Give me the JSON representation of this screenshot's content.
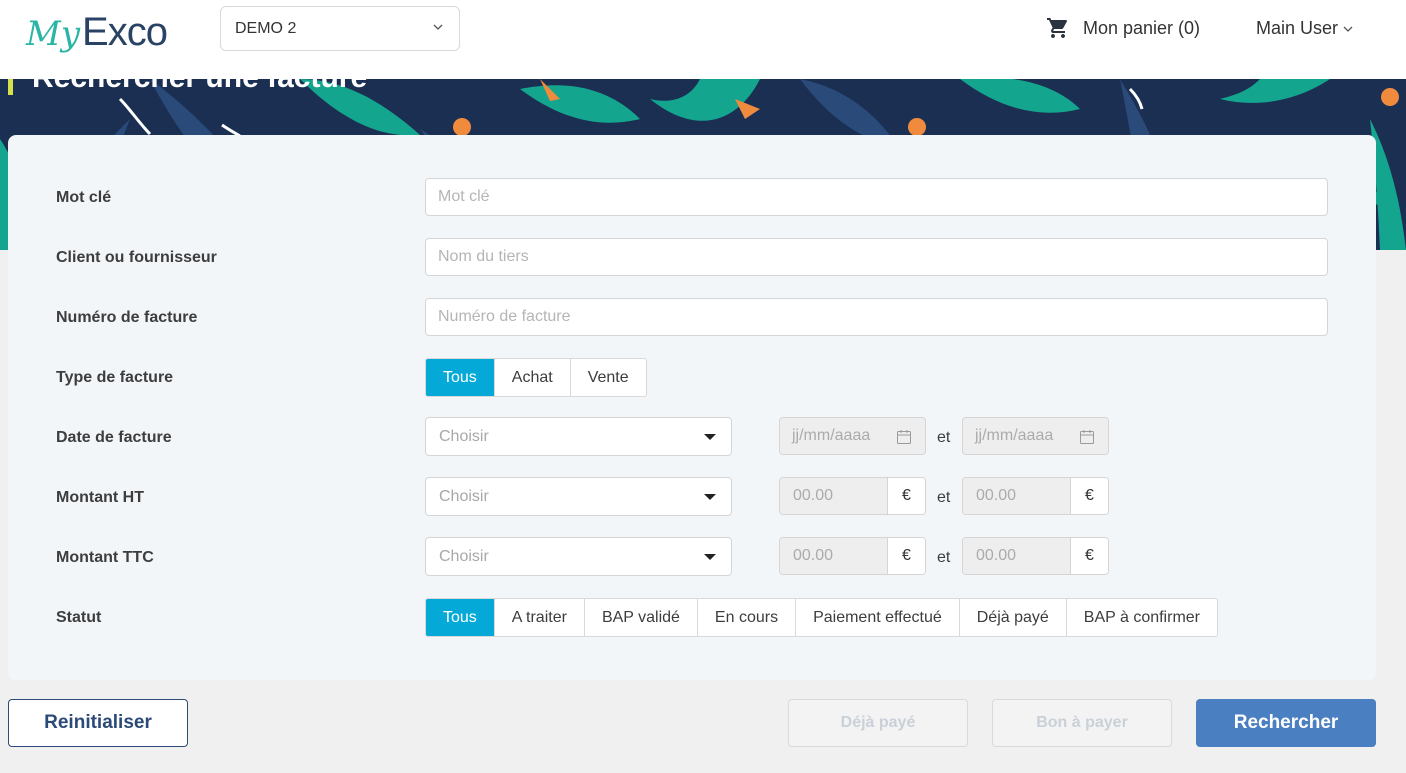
{
  "header": {
    "logo_my": "My",
    "logo_exco": "Exco",
    "company": "DEMO 2",
    "cart_label": "Mon panier (0)",
    "user_label": "Main User"
  },
  "page": {
    "title": "Rechercher une facture"
  },
  "form": {
    "keyword": {
      "label": "Mot clé",
      "placeholder": "Mot clé"
    },
    "party": {
      "label": "Client ou fournisseur",
      "placeholder": "Nom du tiers"
    },
    "invoice_number": {
      "label": "Numéro de facture",
      "placeholder": "Numéro de facture"
    },
    "invoice_type": {
      "label": "Type de facture",
      "options": [
        "Tous",
        "Achat",
        "Vente"
      ],
      "selected": "Tous"
    },
    "invoice_date": {
      "label": "Date de facture",
      "select_value": "Choisir",
      "from_placeholder": "jj/mm/aaaa",
      "to_placeholder": "jj/mm/aaaa",
      "between": "et"
    },
    "amount_ht": {
      "label": "Montant HT",
      "select_value": "Choisir",
      "from_value": "00.00",
      "to_value": "00.00",
      "currency": "€",
      "between": "et"
    },
    "amount_ttc": {
      "label": "Montant TTC",
      "select_value": "Choisir",
      "from_value": "00.00",
      "to_value": "00.00",
      "currency": "€",
      "between": "et"
    },
    "status": {
      "label": "Statut",
      "options": [
        "Tous",
        "A traiter",
        "BAP validé",
        "En cours",
        "Paiement effectué",
        "Déjà payé",
        "BAP à confirmer"
      ],
      "selected": "Tous"
    }
  },
  "actions": {
    "reset": "Reinitialiser",
    "already_paid": "Déjà payé",
    "good_to_pay": "Bon à payer",
    "search": "Rechercher"
  },
  "colors": {
    "accent_active": "#04a9d8",
    "primary_button": "#4a7fc1",
    "brand_navy": "#2c4a77",
    "logo_teal": "#2bb5a6"
  },
  "icons": [
    "cart-icon",
    "chevron-down-icon",
    "calendar-icon",
    "caret-down-icon"
  ]
}
